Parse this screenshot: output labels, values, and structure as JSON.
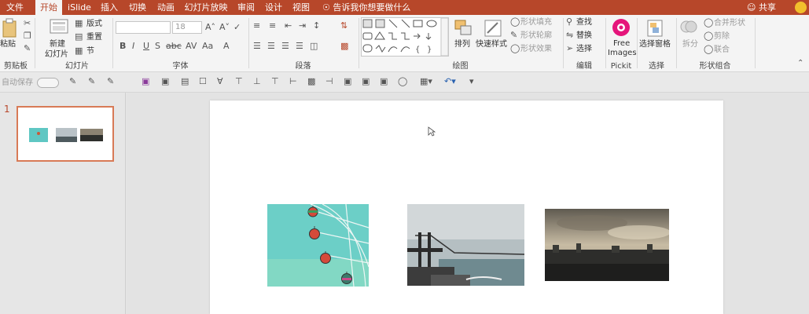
{
  "menubar": {
    "tabs": [
      "文件",
      "开始",
      "iSlide",
      "插入",
      "切换",
      "动画",
      "幻灯片放映",
      "审阅",
      "设计",
      "视图"
    ],
    "active_tab": "开始",
    "tellme": "告诉我你想要做什么",
    "share": "共享"
  },
  "ribbon": {
    "clipboard": {
      "paste": "粘贴",
      "group": "剪贴板"
    },
    "slides": {
      "new_slide_line1": "新建",
      "new_slide_line2": "幻灯片",
      "layout": "版式",
      "reset": "重置",
      "section": "节",
      "group": "幻灯片"
    },
    "font": {
      "size": "18",
      "group": "字体"
    },
    "paragraph": {
      "group": "段落"
    },
    "drawing": {
      "arrange": "排列",
      "quick_styles": "快速样式",
      "shape_fill": "形状填充",
      "shape_outline": "形状轮廓",
      "shape_effects": "形状效果",
      "group": "绘图"
    },
    "editing": {
      "find": "查找",
      "replace": "替换",
      "select": "选择",
      "group": "编辑"
    },
    "pickit": {
      "line1": "Free",
      "line2": "Images",
      "group": "Pickit"
    },
    "selection": {
      "pane": "选择窗格",
      "group": "选择"
    },
    "shape_combine": {
      "split": "拆分",
      "union": "合并形状",
      "subtract": "剪除",
      "combine": "联合",
      "group": "形状组合"
    }
  },
  "qat": {
    "autosave": "自动保存"
  },
  "slide_panel": {
    "slide_number": "1"
  },
  "colors": {
    "accent": "#b7472a",
    "selection_border": "#d87a56",
    "pickit": "#e5157b"
  }
}
